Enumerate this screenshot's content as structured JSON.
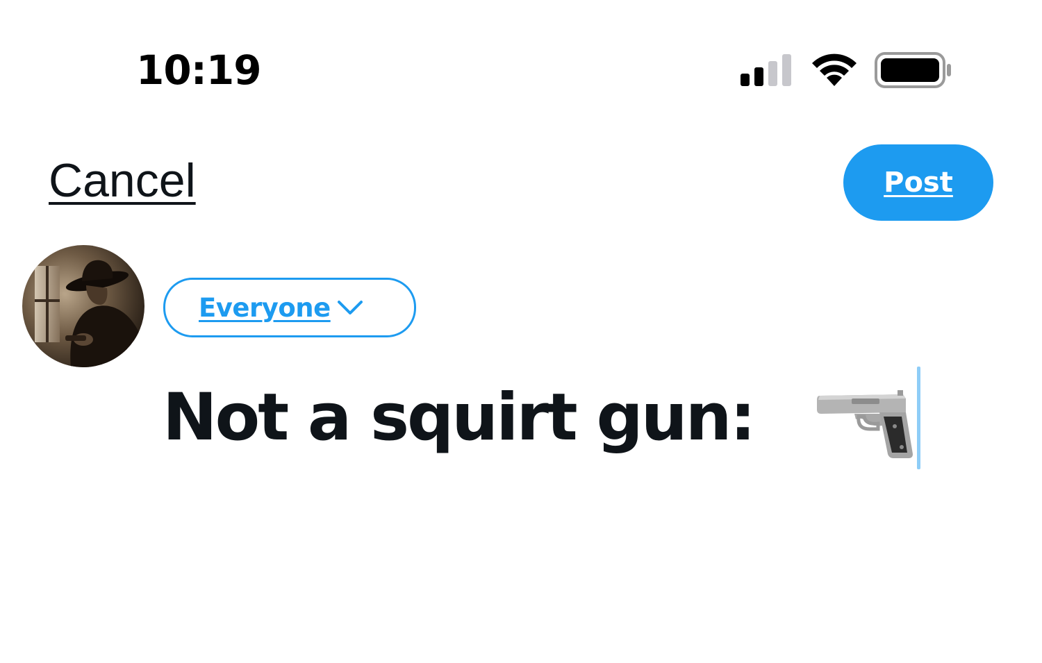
{
  "status_bar": {
    "time": "10:19",
    "icons": [
      "cellular-signal-icon",
      "wifi-icon",
      "battery-icon"
    ]
  },
  "header": {
    "cancel_label": "Cancel",
    "post_label": "Post"
  },
  "composer": {
    "avatar_icon": "user-avatar",
    "audience_label": "Everyone",
    "audience_icon": "chevron-down-icon",
    "text": "Not a squirt gun:",
    "emoji_icon": "pistol-icon"
  },
  "colors": {
    "accent": "#1d9bf0",
    "text": "#0f1419",
    "background": "#ffffff",
    "cursor": "#8ecdf7"
  }
}
